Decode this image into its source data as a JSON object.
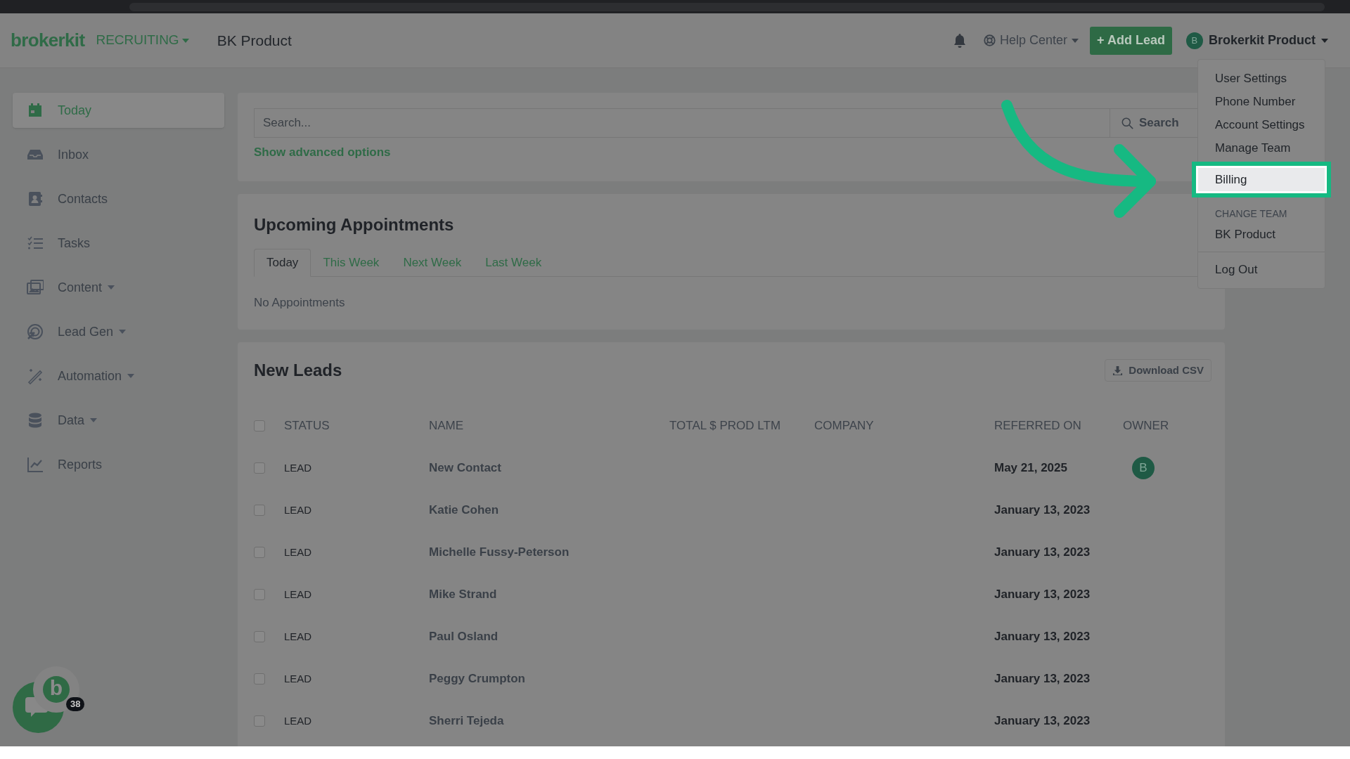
{
  "header": {
    "logo": "brokerkit",
    "module": "RECRUITING",
    "team": "BK Product",
    "help": "Help Center",
    "add_lead": "+ Add Lead",
    "account": {
      "initial": "B",
      "name": "Brokerkit Product"
    }
  },
  "account_menu": {
    "items": [
      {
        "kind": "item",
        "label": "User Settings",
        "selected": false
      },
      {
        "kind": "item",
        "label": "Phone Number",
        "selected": false
      },
      {
        "kind": "item",
        "label": "Account Settings",
        "selected": false
      },
      {
        "kind": "item",
        "label": "Manage Team",
        "selected": false
      },
      {
        "kind": "item",
        "label": "Billing",
        "selected": true
      },
      {
        "kind": "heading",
        "label": "CHANGE TEAM"
      },
      {
        "kind": "item",
        "label": "BK Product",
        "selected": false
      },
      {
        "kind": "divider"
      },
      {
        "kind": "item",
        "label": "Log Out",
        "selected": false
      }
    ]
  },
  "sidebar": {
    "items": [
      {
        "label": "Today",
        "selected": true,
        "expandable": false
      },
      {
        "label": "Inbox",
        "selected": false,
        "expandable": false
      },
      {
        "label": "Contacts",
        "selected": false,
        "expandable": false
      },
      {
        "label": "Tasks",
        "selected": false,
        "expandable": false
      },
      {
        "label": "Content",
        "selected": false,
        "expandable": true
      },
      {
        "label": "Lead Gen",
        "selected": false,
        "expandable": true
      },
      {
        "label": "Automation",
        "selected": false,
        "expandable": true
      },
      {
        "label": "Data",
        "selected": false,
        "expandable": true
      },
      {
        "label": "Reports",
        "selected": false,
        "expandable": false
      }
    ]
  },
  "search": {
    "placeholder": "Search...",
    "button": "Search",
    "advanced": "Show advanced options"
  },
  "appointments": {
    "title": "Upcoming Appointments",
    "tabs": [
      {
        "label": "Today",
        "selected": true
      },
      {
        "label": "This Week",
        "selected": false
      },
      {
        "label": "Next Week",
        "selected": false
      },
      {
        "label": "Last Week",
        "selected": false
      }
    ],
    "empty": "No Appointments"
  },
  "new_leads": {
    "title": "New Leads",
    "download": "Download CSV",
    "select_all_checked": false,
    "columns": [
      "STATUS",
      "NAME",
      "TOTAL $ PROD LTM",
      "COMPANY",
      "REFERRED ON",
      "OWNER"
    ],
    "rows": [
      {
        "checked": false,
        "status": "LEAD",
        "name": "New Contact",
        "referred_on": "May 21, 2025",
        "owner": "B"
      },
      {
        "checked": false,
        "status": "LEAD",
        "name": "Katie Cohen",
        "referred_on": "January 13, 2023"
      },
      {
        "checked": false,
        "status": "LEAD",
        "name": "Michelle Fussy-Peterson",
        "referred_on": "January 13, 2023"
      },
      {
        "checked": false,
        "status": "LEAD",
        "name": "Mike Strand",
        "referred_on": "January 13, 2023"
      },
      {
        "checked": false,
        "status": "LEAD",
        "name": "Paul Osland",
        "referred_on": "January 13, 2023"
      },
      {
        "checked": false,
        "status": "LEAD",
        "name": "Peggy Crumpton",
        "referred_on": "January 13, 2023"
      },
      {
        "checked": false,
        "status": "LEAD",
        "name": "Sherri Tejeda",
        "referred_on": "January 13, 2023"
      }
    ]
  },
  "chat_widget": {
    "logo": "b",
    "badge": "38"
  }
}
